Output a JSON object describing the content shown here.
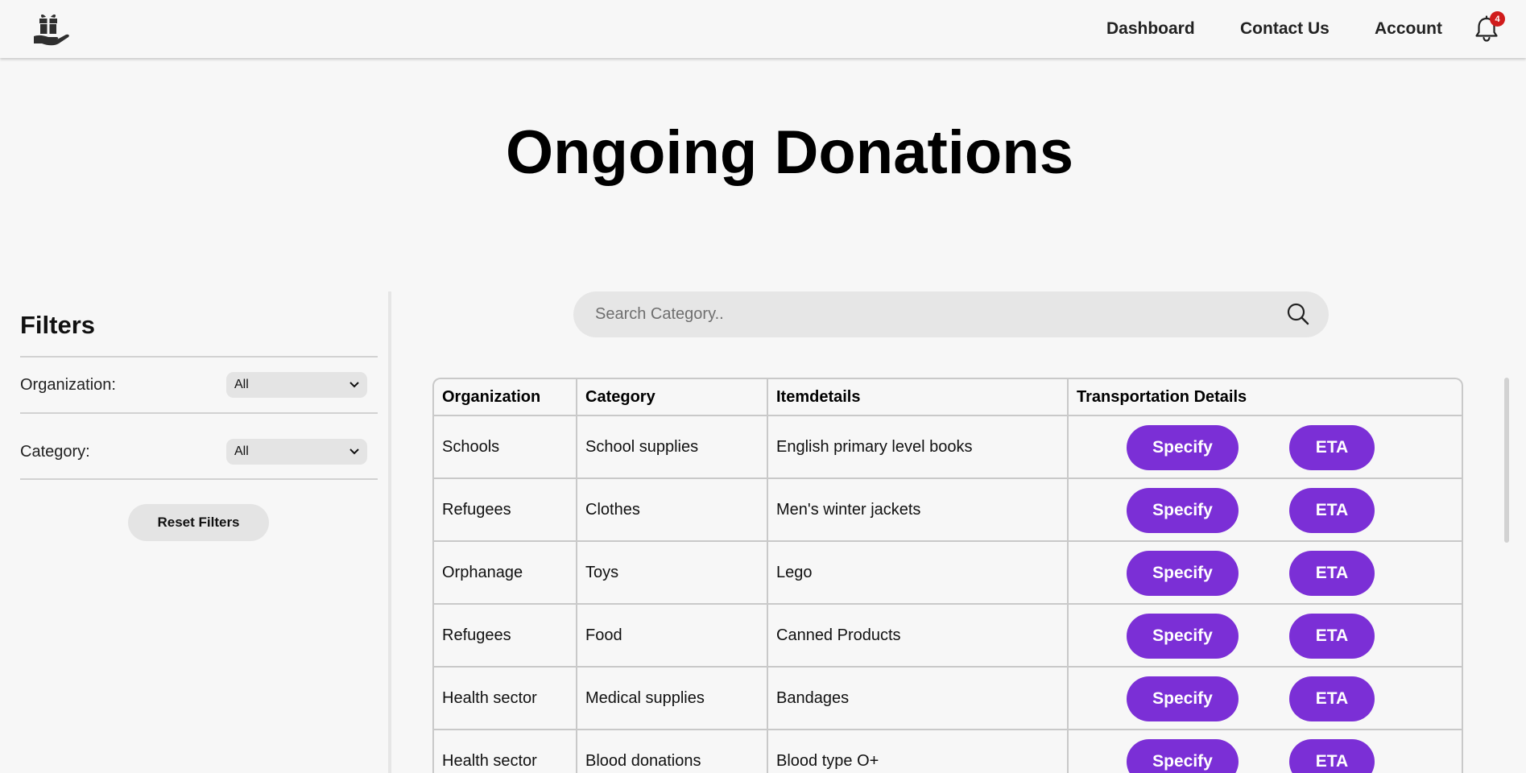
{
  "header": {
    "logo_icon": "gift-in-hand-icon",
    "nav": [
      "Dashboard",
      "Contact Us",
      "Account"
    ],
    "notification_count": "4"
  },
  "page": {
    "title": "Ongoing Donations"
  },
  "filters": {
    "title": "Filters",
    "organization_label": "Organization:",
    "organization_value": "All",
    "category_label": "Category:",
    "category_value": "All",
    "reset_label": "Reset Filters"
  },
  "search": {
    "placeholder": "Search Category.."
  },
  "table": {
    "headers": [
      "Organization",
      "Category",
      "Itemdetails",
      "Transportation Details"
    ],
    "rows": [
      {
        "organization": "Schools",
        "category": "School supplies",
        "item": "English primary level books"
      },
      {
        "organization": "Refugees",
        "category": "Clothes",
        "item": "Men's winter jackets"
      },
      {
        "organization": "Orphanage",
        "category": "Toys",
        "item": "Lego"
      },
      {
        "organization": "Refugees",
        "category": "Food",
        "item": "Canned Products"
      },
      {
        "organization": "Health sector",
        "category": "Medical supplies",
        "item": "Bandages"
      },
      {
        "organization": "Health sector",
        "category": "Blood donations",
        "item": "Blood type O+"
      }
    ],
    "specify_label": "Specify",
    "eta_label": "ETA"
  },
  "colors": {
    "accent": "#7b2fd6",
    "badge": "#d01b1b"
  }
}
